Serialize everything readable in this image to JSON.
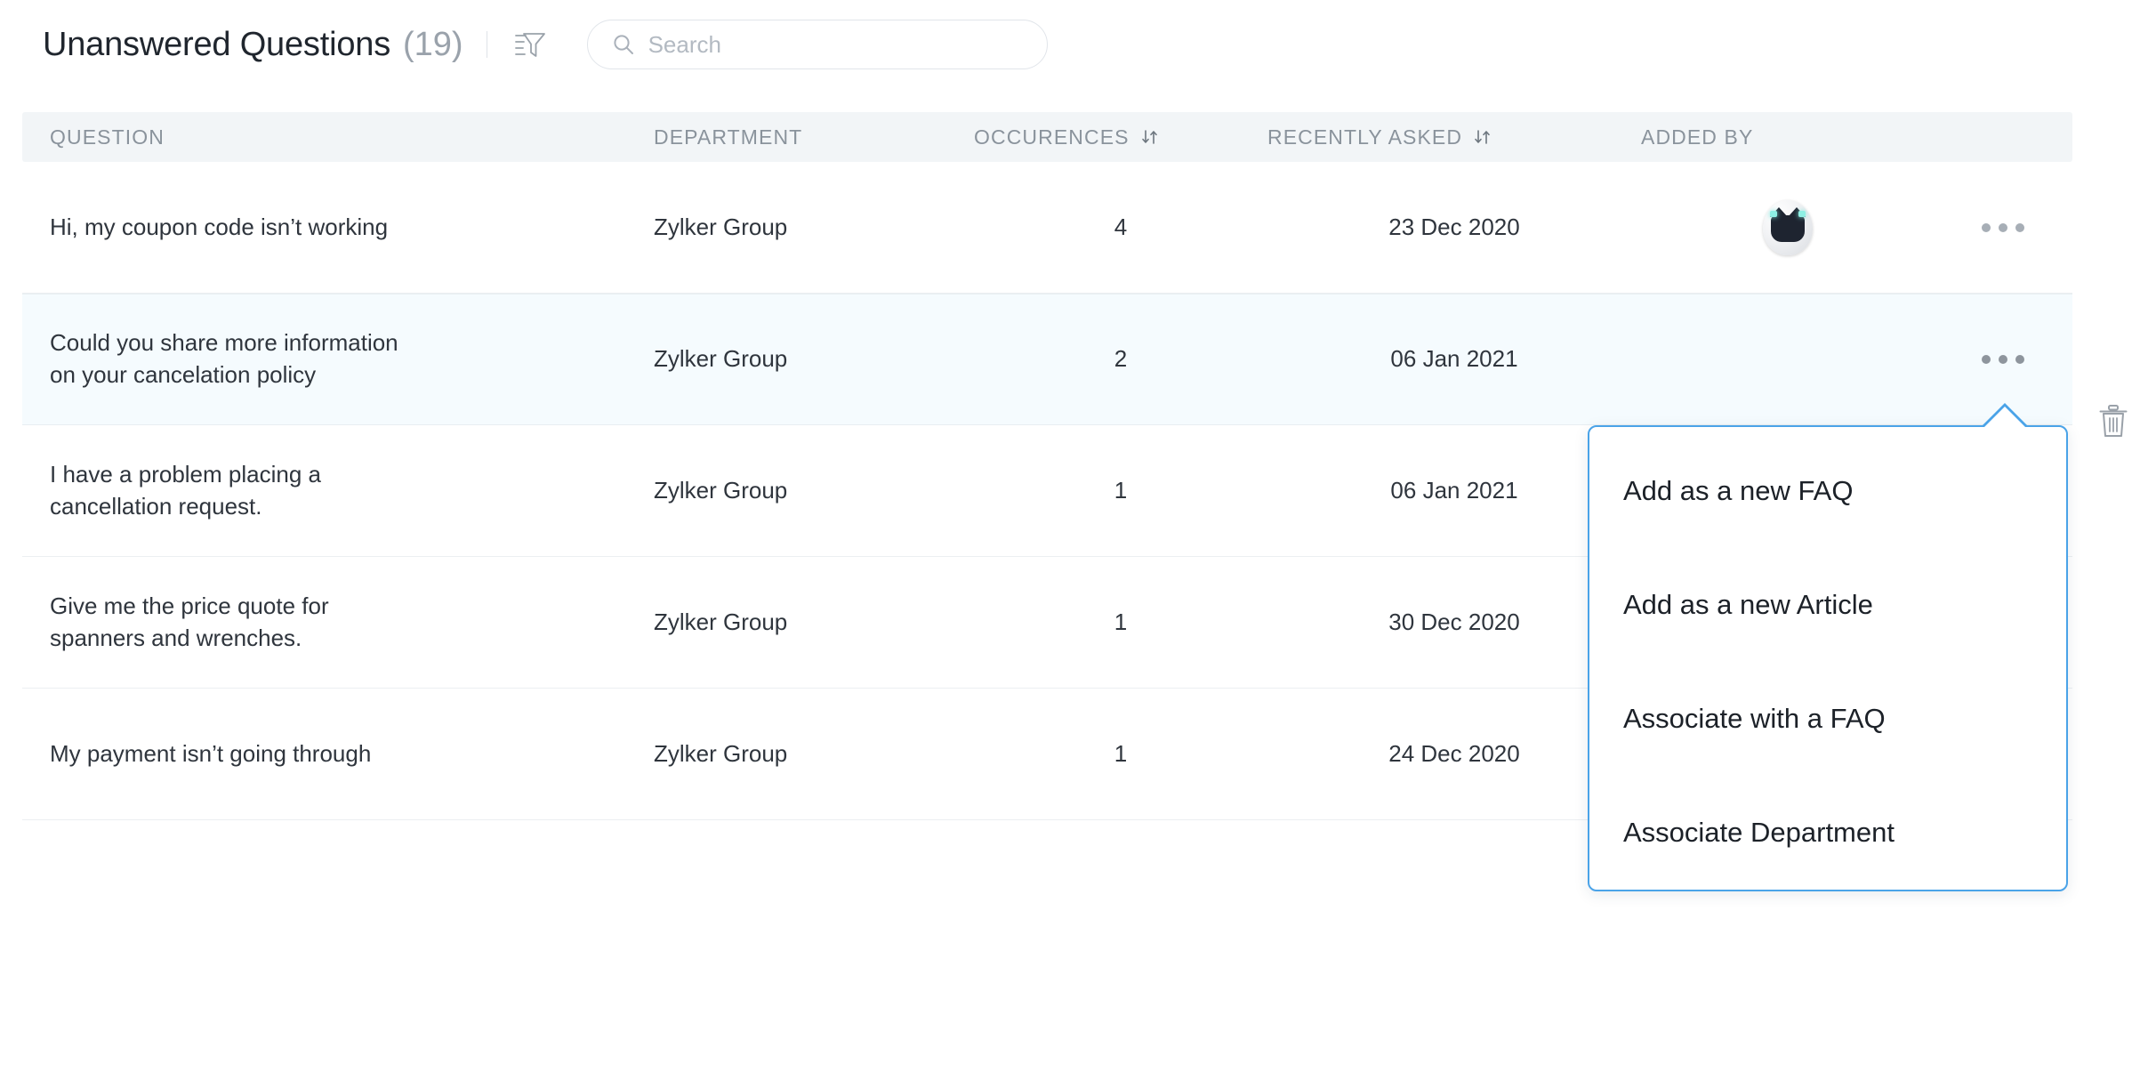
{
  "header": {
    "title": "Unanswered Questions",
    "count": "(19)",
    "filter_icon": "filter-funnel-icon",
    "search": {
      "placeholder": "Search",
      "value": "",
      "icon": "search-icon"
    }
  },
  "table": {
    "columns": [
      {
        "key": "question",
        "label": "QUESTION",
        "sortable": false
      },
      {
        "key": "department",
        "label": "DEPARTMENT",
        "sortable": false
      },
      {
        "key": "occurences",
        "label": "OCCURENCES",
        "sortable": true,
        "sort_icon": "sort-updown-icon"
      },
      {
        "key": "recently",
        "label": "RECENTLY ASKED",
        "sortable": true,
        "sort_icon": "sort-updown-icon"
      },
      {
        "key": "addedby",
        "label": "ADDED BY",
        "sortable": false
      }
    ],
    "rows": [
      {
        "question": "Hi, my coupon code isn’t working",
        "question_lines": [
          "Hi, my coupon code isn’t working"
        ],
        "department": "Zylker Group",
        "occurences": "4",
        "recently_asked": "23 Dec 2020",
        "added_by": "bot-avatar",
        "selected": false,
        "menu_open": false
      },
      {
        "question": "Could you share more information on your cancelation policy",
        "question_lines": [
          "Could you share more information",
          "on your cancelation policy"
        ],
        "department": "Zylker Group",
        "occurences": "2",
        "recently_asked": "06 Jan 2021",
        "added_by": "bot-avatar",
        "selected": true,
        "menu_open": true
      },
      {
        "question": "I have a problem placing a cancellation request.",
        "question_lines": [
          "I have a problem placing a",
          "cancellation request."
        ],
        "department": "Zylker Group",
        "occurences": "1",
        "recently_asked": "06 Jan 2021",
        "added_by": "bot-avatar",
        "selected": false,
        "menu_open": false
      },
      {
        "question": "Give me the price quote for spanners and wrenches.",
        "question_lines": [
          "Give me the price quote for",
          "spanners and wrenches."
        ],
        "department": "Zylker Group",
        "occurences": "1",
        "recently_asked": "30 Dec 2020",
        "added_by": "bot-avatar",
        "selected": false,
        "menu_open": false
      },
      {
        "question": "My payment isn’t going through",
        "question_lines": [
          "My payment isn’t going through"
        ],
        "department": "Zylker Group",
        "occurences": "1",
        "recently_asked": "24 Dec 2020",
        "added_by": "bot-avatar",
        "selected": false,
        "menu_open": false
      }
    ]
  },
  "context_menu": {
    "items": [
      {
        "label": "Add as a new FAQ"
      },
      {
        "label": "Add as a new Article"
      },
      {
        "label": "Associate with a FAQ"
      },
      {
        "label": "Associate Department"
      }
    ]
  },
  "right_rail": {
    "delete_icon": "trash-icon"
  },
  "colors": {
    "accent": "#4aa3e8",
    "row_selected_bg": "#f5fbfe",
    "header_bg": "#f2f5f7",
    "text_primary": "#2f353d",
    "text_muted": "#8a939c"
  }
}
